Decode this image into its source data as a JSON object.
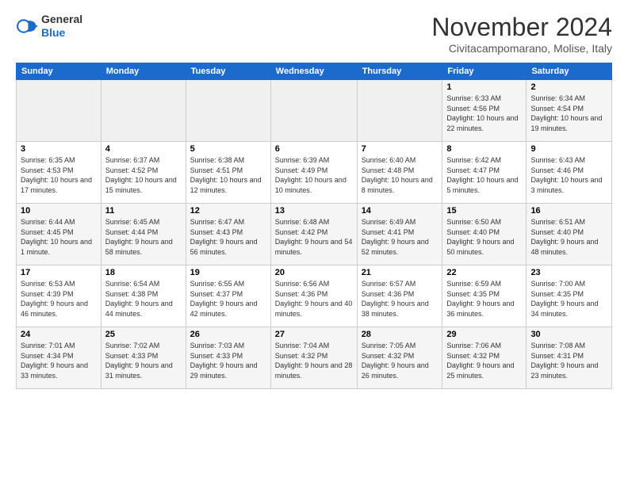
{
  "logo": {
    "general": "General",
    "blue": "Blue"
  },
  "header": {
    "title": "November 2024",
    "location": "Civitacampomarano, Molise, Italy"
  },
  "weekdays": [
    "Sunday",
    "Monday",
    "Tuesday",
    "Wednesday",
    "Thursday",
    "Friday",
    "Saturday"
  ],
  "weeks": [
    [
      {
        "day": "",
        "info": ""
      },
      {
        "day": "",
        "info": ""
      },
      {
        "day": "",
        "info": ""
      },
      {
        "day": "",
        "info": ""
      },
      {
        "day": "",
        "info": ""
      },
      {
        "day": "1",
        "info": "Sunrise: 6:33 AM\nSunset: 4:56 PM\nDaylight: 10 hours and 22 minutes."
      },
      {
        "day": "2",
        "info": "Sunrise: 6:34 AM\nSunset: 4:54 PM\nDaylight: 10 hours and 19 minutes."
      }
    ],
    [
      {
        "day": "3",
        "info": "Sunrise: 6:35 AM\nSunset: 4:53 PM\nDaylight: 10 hours and 17 minutes."
      },
      {
        "day": "4",
        "info": "Sunrise: 6:37 AM\nSunset: 4:52 PM\nDaylight: 10 hours and 15 minutes."
      },
      {
        "day": "5",
        "info": "Sunrise: 6:38 AM\nSunset: 4:51 PM\nDaylight: 10 hours and 12 minutes."
      },
      {
        "day": "6",
        "info": "Sunrise: 6:39 AM\nSunset: 4:49 PM\nDaylight: 10 hours and 10 minutes."
      },
      {
        "day": "7",
        "info": "Sunrise: 6:40 AM\nSunset: 4:48 PM\nDaylight: 10 hours and 8 minutes."
      },
      {
        "day": "8",
        "info": "Sunrise: 6:42 AM\nSunset: 4:47 PM\nDaylight: 10 hours and 5 minutes."
      },
      {
        "day": "9",
        "info": "Sunrise: 6:43 AM\nSunset: 4:46 PM\nDaylight: 10 hours and 3 minutes."
      }
    ],
    [
      {
        "day": "10",
        "info": "Sunrise: 6:44 AM\nSunset: 4:45 PM\nDaylight: 10 hours and 1 minute."
      },
      {
        "day": "11",
        "info": "Sunrise: 6:45 AM\nSunset: 4:44 PM\nDaylight: 9 hours and 58 minutes."
      },
      {
        "day": "12",
        "info": "Sunrise: 6:47 AM\nSunset: 4:43 PM\nDaylight: 9 hours and 56 minutes."
      },
      {
        "day": "13",
        "info": "Sunrise: 6:48 AM\nSunset: 4:42 PM\nDaylight: 9 hours and 54 minutes."
      },
      {
        "day": "14",
        "info": "Sunrise: 6:49 AM\nSunset: 4:41 PM\nDaylight: 9 hours and 52 minutes."
      },
      {
        "day": "15",
        "info": "Sunrise: 6:50 AM\nSunset: 4:40 PM\nDaylight: 9 hours and 50 minutes."
      },
      {
        "day": "16",
        "info": "Sunrise: 6:51 AM\nSunset: 4:40 PM\nDaylight: 9 hours and 48 minutes."
      }
    ],
    [
      {
        "day": "17",
        "info": "Sunrise: 6:53 AM\nSunset: 4:39 PM\nDaylight: 9 hours and 46 minutes."
      },
      {
        "day": "18",
        "info": "Sunrise: 6:54 AM\nSunset: 4:38 PM\nDaylight: 9 hours and 44 minutes."
      },
      {
        "day": "19",
        "info": "Sunrise: 6:55 AM\nSunset: 4:37 PM\nDaylight: 9 hours and 42 minutes."
      },
      {
        "day": "20",
        "info": "Sunrise: 6:56 AM\nSunset: 4:36 PM\nDaylight: 9 hours and 40 minutes."
      },
      {
        "day": "21",
        "info": "Sunrise: 6:57 AM\nSunset: 4:36 PM\nDaylight: 9 hours and 38 minutes."
      },
      {
        "day": "22",
        "info": "Sunrise: 6:59 AM\nSunset: 4:35 PM\nDaylight: 9 hours and 36 minutes."
      },
      {
        "day": "23",
        "info": "Sunrise: 7:00 AM\nSunset: 4:35 PM\nDaylight: 9 hours and 34 minutes."
      }
    ],
    [
      {
        "day": "24",
        "info": "Sunrise: 7:01 AM\nSunset: 4:34 PM\nDaylight: 9 hours and 33 minutes."
      },
      {
        "day": "25",
        "info": "Sunrise: 7:02 AM\nSunset: 4:33 PM\nDaylight: 9 hours and 31 minutes."
      },
      {
        "day": "26",
        "info": "Sunrise: 7:03 AM\nSunset: 4:33 PM\nDaylight: 9 hours and 29 minutes."
      },
      {
        "day": "27",
        "info": "Sunrise: 7:04 AM\nSunset: 4:32 PM\nDaylight: 9 hours and 28 minutes."
      },
      {
        "day": "28",
        "info": "Sunrise: 7:05 AM\nSunset: 4:32 PM\nDaylight: 9 hours and 26 minutes."
      },
      {
        "day": "29",
        "info": "Sunrise: 7:06 AM\nSunset: 4:32 PM\nDaylight: 9 hours and 25 minutes."
      },
      {
        "day": "30",
        "info": "Sunrise: 7:08 AM\nSunset: 4:31 PM\nDaylight: 9 hours and 23 minutes."
      }
    ]
  ]
}
